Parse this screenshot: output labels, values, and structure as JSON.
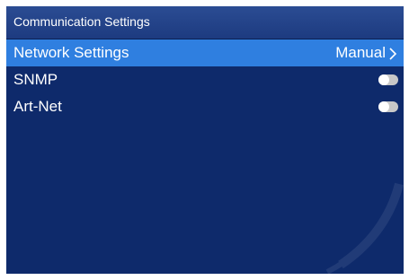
{
  "title_bar": {
    "title": "Communication Settings"
  },
  "menu": {
    "items": [
      {
        "label": "Network Settings",
        "value": "Manual",
        "kind": "submenu",
        "selected": true,
        "icon": "chevron-right-icon"
      },
      {
        "label": "SNMP",
        "kind": "toggle",
        "state": "off",
        "selected": false
      },
      {
        "label": "Art-Net",
        "kind": "toggle",
        "state": "off",
        "selected": false
      }
    ]
  },
  "colors": {
    "background": "#0e2a6b",
    "title_bar": "#1d3b80",
    "selected_row": "#2f7fe0",
    "text": "#ffffff",
    "toggle_track": "#c8c8c8",
    "toggle_knob": "#ffffff"
  }
}
